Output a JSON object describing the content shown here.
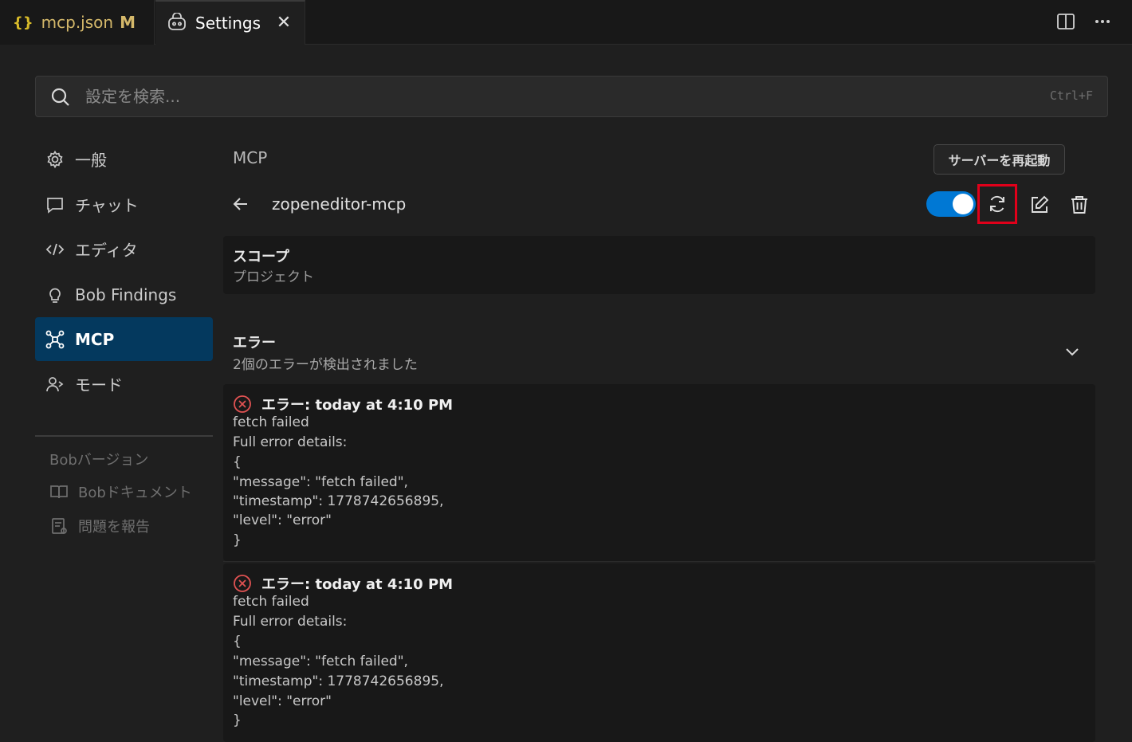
{
  "tabs": [
    {
      "icon": "json-braces-icon",
      "label": "mcp.json",
      "badge": "M"
    },
    {
      "icon": "settings-tab-icon",
      "label": "Settings",
      "close": "✕"
    }
  ],
  "search": {
    "placeholder": "設定を検索...",
    "shortcut": "Ctrl+F"
  },
  "sidebar": {
    "items": [
      {
        "icon": "gear-icon",
        "label": "一般"
      },
      {
        "icon": "chat-icon",
        "label": "チャット"
      },
      {
        "icon": "code-icon",
        "label": "エディタ"
      },
      {
        "icon": "lightbulb-icon",
        "label": "Bob Findings"
      },
      {
        "icon": "mcp-icon",
        "label": "MCP",
        "active": true
      },
      {
        "icon": "person-icon",
        "label": "モード"
      }
    ],
    "version_label": "Bobバージョン",
    "docs_label": "Bobドキュメント",
    "report_label": "問題を報告"
  },
  "main": {
    "section_title": "MCP",
    "server_name": "zopeneditor-mcp",
    "enabled": true,
    "tooltip": "サーバーを再起動",
    "scope": {
      "title": "スコープ",
      "value": "プロジェクト"
    },
    "errors": {
      "title": "エラー",
      "summary": "2個のエラーが検出されました",
      "items": [
        {
          "heading": "エラー: today at 4:10 PM",
          "lines": [
            "fetch failed",
            "Full error details:",
            "{",
            "\"message\": \"fetch failed\",",
            "\"timestamp\": 1778742656895,",
            "\"level\": \"error\"",
            "}"
          ]
        },
        {
          "heading": "エラー: today at 4:10 PM",
          "lines": [
            "fetch failed",
            "Full error details:",
            "{",
            "\"message\": \"fetch failed\",",
            "\"timestamp\": 1778742656895,",
            "\"level\": \"error\"",
            "}"
          ]
        }
      ]
    }
  },
  "colors": {
    "accent": "#0078d4",
    "active_bg": "#04395e",
    "highlight": "#e0001a",
    "error": "#e05252"
  }
}
